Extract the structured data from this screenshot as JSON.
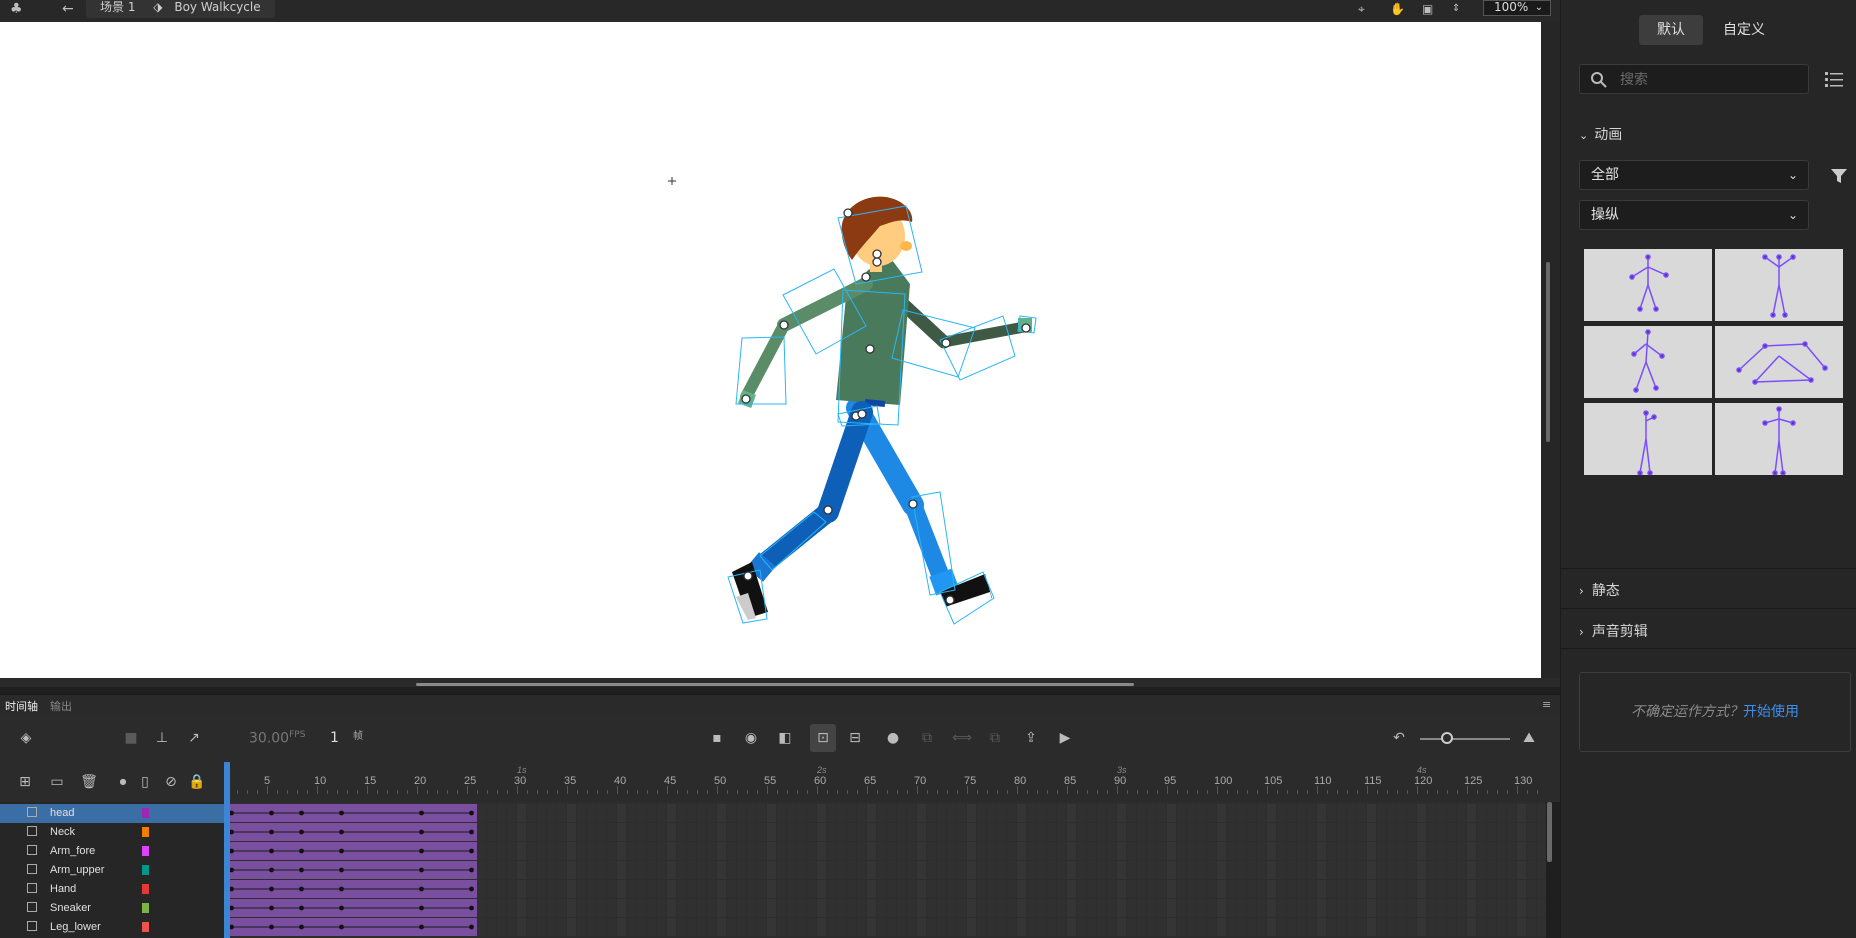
{
  "topbar": {
    "scene_label": "场景 1",
    "symbol_label": "Boy Walkcycle",
    "zoom_value": "100%"
  },
  "right_panel": {
    "tabs": [
      {
        "label": "默认"
      },
      {
        "label": "自定义"
      }
    ],
    "search_placeholder": "搜索",
    "animation_section": "动画",
    "dropdown_category": "全部",
    "dropdown_type": "操纵",
    "static_section": "静态",
    "sound_section": "声音剪辑",
    "help_text": "不确定运作方式？",
    "help_link": "开始使用"
  },
  "timeline": {
    "tab_timeline": "时间轴",
    "tab_output": "输出",
    "fps_value": "30.00",
    "fps_unit": "FPS",
    "current_frame": "1",
    "frame_unit": "帧",
    "second_markers": [
      "1s",
      "2s",
      "3s",
      "4s"
    ],
    "frame_numbers": [
      "5",
      "10",
      "15",
      "20",
      "25",
      "30",
      "35",
      "40",
      "45",
      "50",
      "55",
      "60",
      "65",
      "70",
      "75",
      "80",
      "85",
      "90",
      "95",
      "100",
      "105",
      "110",
      "115",
      "120",
      "125",
      "130"
    ],
    "layers": [
      {
        "name": "head",
        "color": "#9c27b0",
        "selected": true
      },
      {
        "name": "Neck",
        "color": "#f57c00",
        "selected": false
      },
      {
        "name": "Arm_fore",
        "color": "#e040fb",
        "selected": false
      },
      {
        "name": "Arm_upper",
        "color": "#009688",
        "selected": false
      },
      {
        "name": "Hand",
        "color": "#e53935",
        "selected": false
      },
      {
        "name": "Sneaker",
        "color": "#7cb342",
        "selected": false
      },
      {
        "name": "Leg_lower",
        "color": "#ef5350",
        "selected": false
      }
    ],
    "tween_color": "#7a4fa0",
    "tween_end_frame": 25
  },
  "colors": {
    "accent": "#3c6ea6",
    "link": "#3d8ff0",
    "skin": "#ffcc80",
    "hair": "#8b3a12",
    "shirt": "#4a7a5c",
    "jeans": "#1565c0"
  }
}
